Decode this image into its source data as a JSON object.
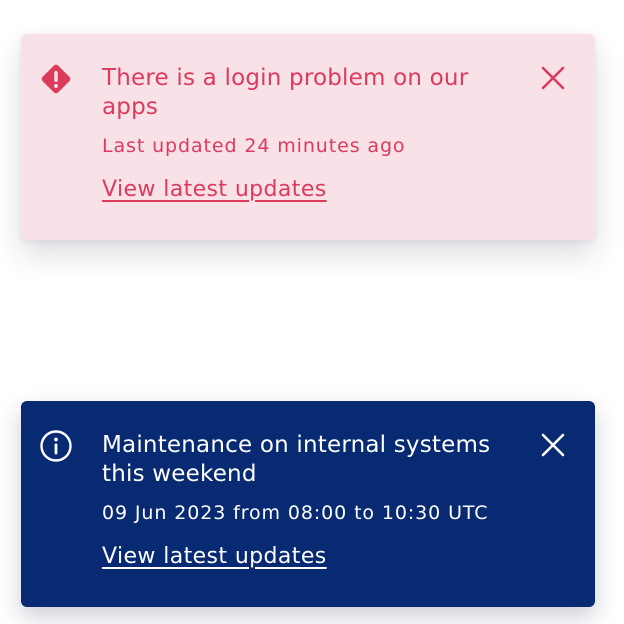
{
  "alert_banner": {
    "title": "There is a login problem on our apps",
    "meta": "Last updated 24 minutes ago",
    "link_label": "View latest updates",
    "icon": "warning-diamond-icon",
    "close_icon": "close-icon",
    "colors": {
      "background": "#f9e1e8",
      "text": "#dc3b5c"
    }
  },
  "info_banner": {
    "title": "Maintenance on internal systems this weekend",
    "meta": "09 Jun 2023 from 08:00 to 10:30 UTC",
    "link_label": "View latest updates",
    "icon": "info-circle-icon",
    "close_icon": "close-icon",
    "colors": {
      "background": "#082a73",
      "text": "#ffffff"
    }
  }
}
